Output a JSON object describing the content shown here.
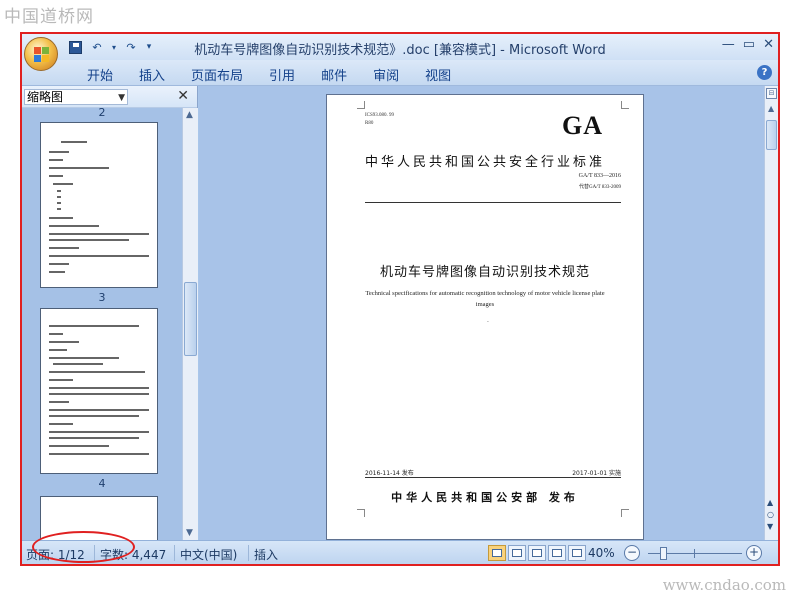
{
  "watermarks": {
    "top": "中国道桥网",
    "bottom": "www.cndao.com"
  },
  "window": {
    "title": "机动车号牌图像自动识别技术规范》.doc [兼容模式] - Microsoft Word",
    "controls": [
      "—",
      "▭",
      "✕"
    ]
  },
  "ribbon": {
    "tabs": [
      "开始",
      "插入",
      "页面布局",
      "引用",
      "邮件",
      "审阅",
      "视图"
    ],
    "help": "?"
  },
  "thumbnail_pane": {
    "view_selector": "缩略图",
    "close": "✕",
    "pages": [
      "2",
      "3",
      "4"
    ]
  },
  "document": {
    "ics_line": "ICS93.080. 99",
    "class_line": "R80",
    "ga": "GA",
    "standard_name": "中华人民共和国公共安全行业标准",
    "code": "GA/T 833—2016",
    "replaces": "代替GA/T 833-2009",
    "title_cn": "机动车号牌图像自动识别技术规范",
    "title_en": "Technical specifications for automatic recognition technology of motor vehicle license plate images",
    "issue_date": "2016-11-14 发布",
    "implement_date": "2017-01-01 实施",
    "issuer": "中华人民共和国公安部 发布"
  },
  "status_bar": {
    "page": "页面: 1/12",
    "words": "字数: 4,447",
    "language": "中文(中国)",
    "mode": "插入",
    "zoom": "40%",
    "zoom_level_percent": 40
  },
  "colors": {
    "highlight": "#e02020",
    "doc_background": "#a8c3e8"
  }
}
